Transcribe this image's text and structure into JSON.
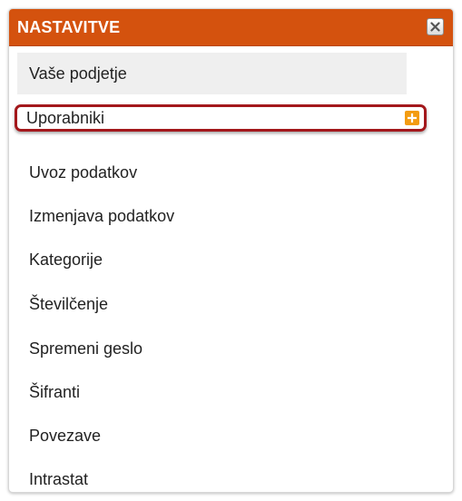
{
  "dialog": {
    "title": "NASTAVITVE",
    "close_icon": "close-icon",
    "header_color": "#d4520e",
    "highlight_color": "#a3181c",
    "accent_color": "#f39c12"
  },
  "menu": {
    "items": [
      {
        "label": "Vaše podjetje"
      },
      {
        "label": "Uporabniki",
        "icon": "plus-icon"
      },
      {
        "label": "Uvoz podatkov"
      },
      {
        "label": "Izmenjava podatkov"
      },
      {
        "label": "Kategorije"
      },
      {
        "label": "Številčenje"
      },
      {
        "label": "Spremeni geslo"
      },
      {
        "label": "Šifranti"
      },
      {
        "label": "Povezave"
      },
      {
        "label": "Intrastat"
      }
    ]
  }
}
